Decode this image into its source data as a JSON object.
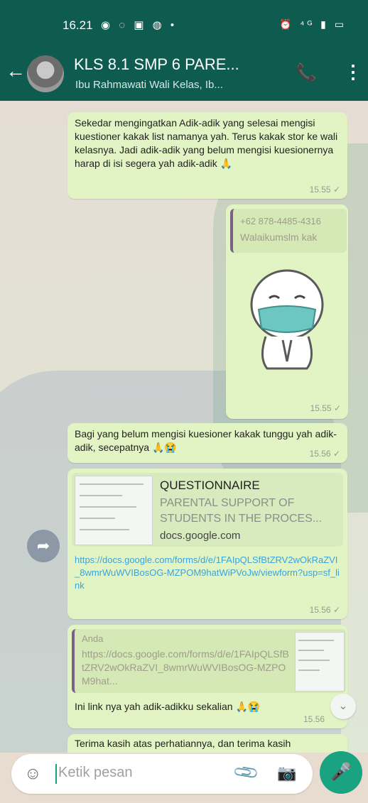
{
  "status": {
    "time": "16.21",
    "left_icons": "◉ ◌ ▣ ◍ •",
    "right_icons": "⏰ ⁴ᴳ ▮ ▭"
  },
  "header": {
    "back_icon": "←",
    "title": "KLS 8.1 SMP 6 PARE...",
    "subtitle": "Ibu Rahmawati Wali Kelas, Ib...",
    "call_icon": "📞",
    "menu_icon": "⋮"
  },
  "messages": [
    {
      "text": "Sekedar mengingatkan Adik-adik yang selesai mengisi kuestioner kakak list namanya yah. Terus kakak stor ke wali kelasnya. Jadi adik-adik yang belum mengisi kuesionernya harap di isi segera yah adik-adik 🙏",
      "time": "15.55 ✓"
    },
    {
      "quote_sender": "+62 878-4485-4316",
      "quote_text": "Walaikumslm kak",
      "time": "15.55 ✓"
    },
    {
      "text": "Bagi yang belum mengisi kuesioner kakak tunggu yah adik-adik, secepatnya 🙏😭",
      "time": "15.56 ✓"
    },
    {
      "preview_title": "QUESTIONNAIRE",
      "preview_desc_1": "PARENTAL SUPPORT OF",
      "preview_desc_2": "STUDENTS IN THE PROCES...",
      "preview_domain": "docs.google.com",
      "link": "https://docs.google.com/forms/d/e/1FAIpQLSfBtZRV2wOkRaZVI_8wmrWuWVIBosOG-MZPOM9hatWiPVoJw/viewform?usp=sf_link",
      "time": "15.56 ✓"
    },
    {
      "quote_sender": "Anda",
      "quote_text": "https://docs.google.com/forms/d/e/1FAIpQLSfBtZRV2wOkRaZVI_8wmrWuWVIBosOG-MZPOM9hat...",
      "text": "Ini link nya yah adik-adikku sekalian 🙏😭",
      "time": "15.56"
    },
    {
      "text": "Terima kasih atas perhatiannya, dan terima kasih"
    }
  ],
  "input": {
    "placeholder": "Ketik pesan",
    "emoji_icon": "☺",
    "attach_icon": "📎",
    "camera_icon": "📷",
    "mic_icon": "🎤"
  },
  "fab": {
    "forward_icon": "➦",
    "scroll_icon": "⌄"
  }
}
